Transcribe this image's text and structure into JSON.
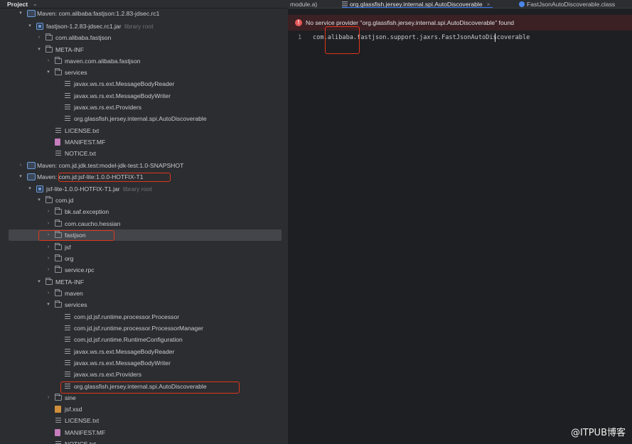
{
  "project": {
    "title": "Project",
    "tree": [
      {
        "label": "Maven: com.alibaba:fastjson:1.2.83-jdsec.rc1",
        "hint": "",
        "icon": "library-icon",
        "arrow": "▾"
      },
      {
        "label": "fastjson-1.2.83-jdsec.rc1.jar",
        "hint": "library root",
        "icon": "jar-icon",
        "arrow": "▾"
      },
      {
        "label": "com.alibaba.fastjson",
        "hint": "",
        "icon": "folder-icon",
        "arrow": "›"
      },
      {
        "label": "META-INF",
        "hint": "",
        "icon": "folder-icon",
        "arrow": "▾"
      },
      {
        "label": "maven.com.alibaba.fastjson",
        "hint": "",
        "icon": "folder-icon",
        "arrow": "›"
      },
      {
        "label": "services",
        "hint": "",
        "icon": "folder-icon",
        "arrow": "▾"
      },
      {
        "label": "javax.ws.rs.ext.MessageBodyReader",
        "hint": "",
        "icon": "text-file-icon",
        "arrow": ""
      },
      {
        "label": "javax.ws.rs.ext.MessageBodyWriter",
        "hint": "",
        "icon": "text-file-icon",
        "arrow": ""
      },
      {
        "label": "javax.ws.rs.ext.Providers",
        "hint": "",
        "icon": "text-file-icon",
        "arrow": ""
      },
      {
        "label": "org.glassfish.jersey.internal.spi.AutoDiscoverable",
        "hint": "",
        "icon": "text-file-icon",
        "arrow": ""
      },
      {
        "label": "LICENSE.txt",
        "hint": "",
        "icon": "text-file-icon",
        "arrow": ""
      },
      {
        "label": "MANIFEST.MF",
        "hint": "",
        "icon": "manifest-icon",
        "arrow": ""
      },
      {
        "label": "NOTICE.txt",
        "hint": "",
        "icon": "text-file-icon",
        "arrow": ""
      },
      {
        "label": "Maven: com.jd.jdk.test:model-jdk-test:1.0-SNAPSHOT",
        "hint": "",
        "icon": "library-icon",
        "arrow": "›"
      },
      {
        "label": "Maven: com.jd:jsf-lite:1.0.0-HOTFIX-T1",
        "hint": "",
        "icon": "library-icon",
        "arrow": "▾"
      },
      {
        "label": "jsf-lite-1.0.0-HOTFIX-T1.jar",
        "hint": "library root",
        "icon": "jar-icon",
        "arrow": "▾"
      },
      {
        "label": "com.jd",
        "hint": "",
        "icon": "folder-icon",
        "arrow": "▾"
      },
      {
        "label": "bk.saf.exception",
        "hint": "",
        "icon": "folder-icon",
        "arrow": "›"
      },
      {
        "label": "com.caucho.hessian",
        "hint": "",
        "icon": "folder-icon",
        "arrow": "›"
      },
      {
        "label": "fastjson",
        "hint": "",
        "icon": "folder-icon",
        "arrow": "›"
      },
      {
        "label": "jsf",
        "hint": "",
        "icon": "folder-icon",
        "arrow": "›"
      },
      {
        "label": "org",
        "hint": "",
        "icon": "folder-icon",
        "arrow": "›"
      },
      {
        "label": "service.rpc",
        "hint": "",
        "icon": "folder-icon",
        "arrow": "›"
      },
      {
        "label": "META-INF",
        "hint": "",
        "icon": "folder-icon",
        "arrow": "▾"
      },
      {
        "label": "maven",
        "hint": "",
        "icon": "folder-icon",
        "arrow": "›"
      },
      {
        "label": "services",
        "hint": "",
        "icon": "folder-icon",
        "arrow": "▾"
      },
      {
        "label": "com.jd.jsf.runtime.processor.Processor",
        "hint": "",
        "icon": "text-file-icon",
        "arrow": ""
      },
      {
        "label": "com.jd.jsf.runtime.processor.ProcessorManager",
        "hint": "",
        "icon": "text-file-icon",
        "arrow": ""
      },
      {
        "label": "com.jd.jsf.runtime.RuntimeConfiguration",
        "hint": "",
        "icon": "text-file-icon",
        "arrow": ""
      },
      {
        "label": "javax.ws.rs.ext.MessageBodyReader",
        "hint": "",
        "icon": "text-file-icon",
        "arrow": ""
      },
      {
        "label": "javax.ws.rs.ext.MessageBodyWriter",
        "hint": "",
        "icon": "text-file-icon",
        "arrow": ""
      },
      {
        "label": "javax.ws.rs.ext.Providers",
        "hint": "",
        "icon": "text-file-icon",
        "arrow": ""
      },
      {
        "label": "org.glassfish.jersey.internal.spi.AutoDiscoverable",
        "hint": "",
        "icon": "text-file-icon",
        "arrow": ""
      },
      {
        "label": "sine",
        "hint": "",
        "icon": "folder-icon",
        "arrow": "›"
      },
      {
        "label": "jsf.xsd",
        "hint": "",
        "icon": "xsd-file-icon",
        "arrow": ""
      },
      {
        "label": "LICENSE.txt",
        "hint": "",
        "icon": "text-file-icon",
        "arrow": ""
      },
      {
        "label": "MANIFEST.MF",
        "hint": "",
        "icon": "manifest-icon",
        "arrow": ""
      },
      {
        "label": "NOTICE.txt",
        "hint": "",
        "icon": "text-file-icon",
        "arrow": ""
      }
    ],
    "selected_label": "fastjson"
  },
  "editor": {
    "tabs": [
      {
        "label": "module.a)",
        "icon": "",
        "active": false
      },
      {
        "label": "org.glassfish.jersey.internal.spi.AutoDiscoverable",
        "icon": "text-file-icon",
        "active": true
      },
      {
        "label": "FastJsonAutoDiscoverable.class",
        "icon": "class-icon",
        "active": false
      }
    ],
    "tab_close_glyph": "×",
    "banner": {
      "icon": "!",
      "text": "No service provider \"org.glassfish.jersey.internal.spi.AutoDiscoverable\" found"
    },
    "line_number": "1",
    "code": "com.alibaba.fastjson.support.jaxrs.FastJsonAutoDiscoverable"
  },
  "watermark": "@ITPUB博客",
  "colors": {
    "highlight_box": "#e0361c",
    "banner_bg": "#3b2024",
    "active_tab_underline": "#3574f0"
  }
}
